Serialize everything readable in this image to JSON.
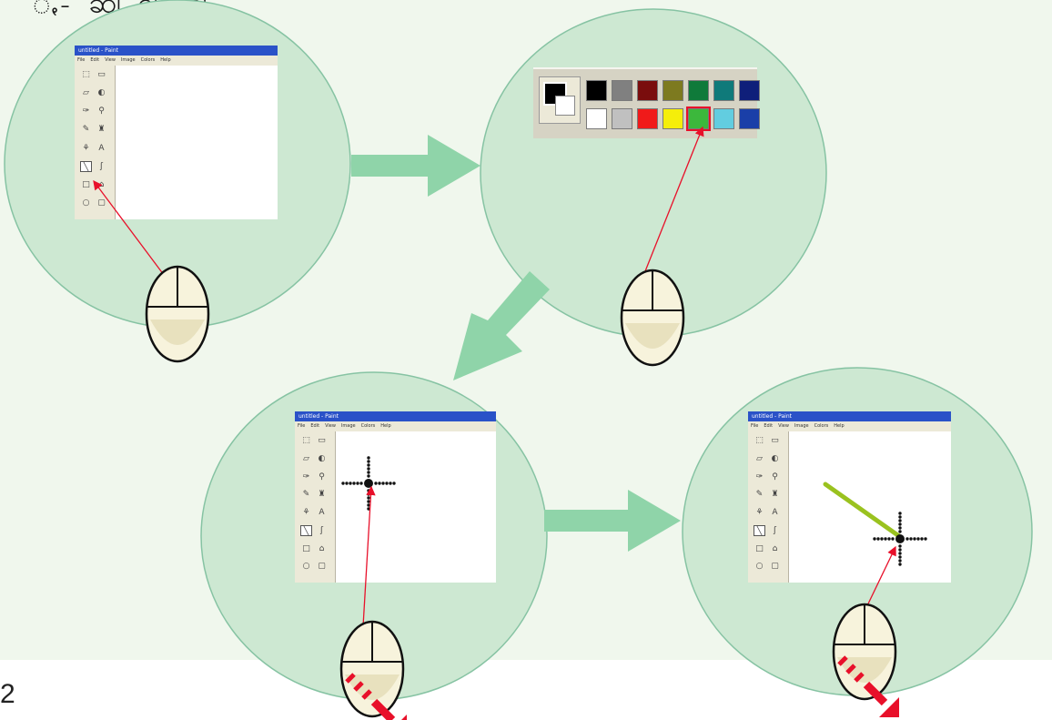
{
  "page": {
    "number": "2",
    "heading": "ꩻꩽ ꩿ ꩾ ꩿꩻ"
  },
  "paint": {
    "title": "untitled - Paint",
    "menu": [
      "File",
      "Edit",
      "View",
      "Image",
      "Colors",
      "Help"
    ],
    "tools": [
      {
        "name": "free-select-icon",
        "glyph": "⬚"
      },
      {
        "name": "select-icon",
        "glyph": "▭"
      },
      {
        "name": "eraser-icon",
        "glyph": "▱"
      },
      {
        "name": "fill-icon",
        "glyph": "◐"
      },
      {
        "name": "eyedropper-icon",
        "glyph": "✑"
      },
      {
        "name": "magnifier-icon",
        "glyph": "⚲"
      },
      {
        "name": "pencil-icon",
        "glyph": "✎"
      },
      {
        "name": "brush-icon",
        "glyph": "♜"
      },
      {
        "name": "airbrush-icon",
        "glyph": "⚘"
      },
      {
        "name": "text-icon",
        "glyph": "A"
      },
      {
        "name": "line-icon",
        "glyph": "╲"
      },
      {
        "name": "curve-icon",
        "glyph": "ʃ"
      },
      {
        "name": "rectangle-icon",
        "glyph": "□"
      },
      {
        "name": "polygon-icon",
        "glyph": "⌂"
      },
      {
        "name": "ellipse-icon",
        "glyph": "○"
      },
      {
        "name": "rounded-rect-icon",
        "glyph": "▢"
      }
    ],
    "selected_tool": 10
  },
  "palette": {
    "foreground": "#000000",
    "background": "#ffffff",
    "top_row": [
      "#000000",
      "#808080",
      "#7a0d0d",
      "#7d7a1f",
      "#0f7a3a",
      "#0f7a7a",
      "#0f1f7a"
    ],
    "bottom_row": [
      "#ffffff",
      "#c0c0c0",
      "#f01a1a",
      "#f5ee0a",
      "#3cb83c",
      "#62cde0",
      "#1a3fa8"
    ],
    "selected_color": "#3cb83c"
  },
  "colors": {
    "circle_fill": "#cde8d2",
    "circle_stroke": "#86c3a3",
    "arrow": "#8fd4a9",
    "pointer_line": "#e8102a",
    "drawn_line": "#9ac21f",
    "mouse_body": "#f7f3dc",
    "drag_arrow": "#e8102a"
  }
}
